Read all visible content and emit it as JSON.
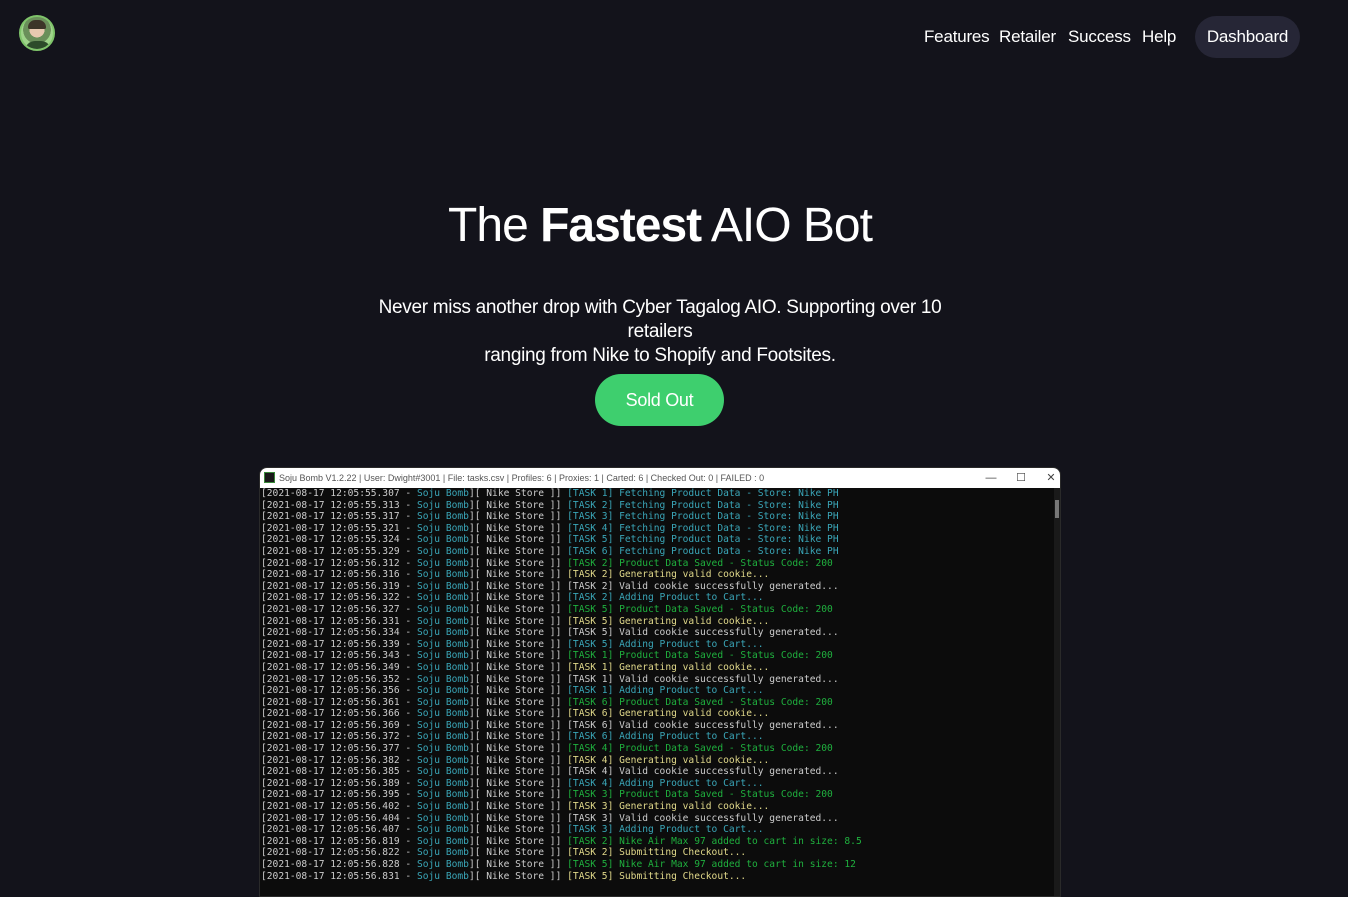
{
  "nav": {
    "links": [
      "Features",
      "Retailer",
      "Success",
      "Help"
    ],
    "dashboard_label": "Dashboard"
  },
  "hero": {
    "title_prefix": "The ",
    "title_bold": "Fastest",
    "title_suffix": " AIO Bot",
    "subtitle_line1": "Never miss another drop with Cyber Tagalog AIO. Supporting over 10 retailers",
    "subtitle_line2": "ranging from Nike to Shopify and Footsites.",
    "cta_label": "Sold Out"
  },
  "colors": {
    "background": "#13131b",
    "cta": "#3ecf6e",
    "dashboard_button": "#262636"
  },
  "console_window": {
    "title": "Soju Bomb V1.2.22 | User: Dwight#3001 | File: tasks.csv | Profiles: 6 | Proxies: 1 | Carted: 6 | Checked Out: 0 | FAILED : 0",
    "controls": [
      "—",
      "☐",
      "✕"
    ],
    "lines": [
      {
        "ts": "[2021-08-17 12:05:55.307 - ",
        "bot": "Soju Bomb",
        "store": "][ Nike Store ]] ",
        "task": "[TASK 1] ",
        "msg": "Fetching Product Data - Store: Nike PH",
        "color": "cyan"
      },
      {
        "ts": "[2021-08-17 12:05:55.313 - ",
        "bot": "Soju Bomb",
        "store": "][ Nike Store ]] ",
        "task": "[TASK 2] ",
        "msg": "Fetching Product Data - Store: Nike PH",
        "color": "cyan"
      },
      {
        "ts": "[2021-08-17 12:05:55.317 - ",
        "bot": "Soju Bomb",
        "store": "][ Nike Store ]] ",
        "task": "[TASK 3] ",
        "msg": "Fetching Product Data - Store: Nike PH",
        "color": "cyan"
      },
      {
        "ts": "[2021-08-17 12:05:55.321 - ",
        "bot": "Soju Bomb",
        "store": "][ Nike Store ]] ",
        "task": "[TASK 4] ",
        "msg": "Fetching Product Data - Store: Nike PH",
        "color": "cyan"
      },
      {
        "ts": "[2021-08-17 12:05:55.324 - ",
        "bot": "Soju Bomb",
        "store": "][ Nike Store ]] ",
        "task": "[TASK 5] ",
        "msg": "Fetching Product Data - Store: Nike PH",
        "color": "cyan"
      },
      {
        "ts": "[2021-08-17 12:05:55.329 - ",
        "bot": "Soju Bomb",
        "store": "][ Nike Store ]] ",
        "task": "[TASK 6] ",
        "msg": "Fetching Product Data - Store: Nike PH",
        "color": "cyan"
      },
      {
        "ts": "[2021-08-17 12:05:56.312 - ",
        "bot": "Soju Bomb",
        "store": "][ Nike Store ]] ",
        "task": "[TASK 2] ",
        "msg": "Product Data Saved - Status Code: 200",
        "color": "green"
      },
      {
        "ts": "[2021-08-17 12:05:56.316 - ",
        "bot": "Soju Bomb",
        "store": "][ Nike Store ]] ",
        "task": "[TASK 2] ",
        "msg": "Generating valid cookie...",
        "color": "yellow"
      },
      {
        "ts": "[2021-08-17 12:05:56.319 - ",
        "bot": "Soju Bomb",
        "store": "][ Nike Store ]] ",
        "task": "[TASK 2] ",
        "msg": "Valid cookie successfully generated...",
        "color": "white"
      },
      {
        "ts": "[2021-08-17 12:05:56.322 - ",
        "bot": "Soju Bomb",
        "store": "][ Nike Store ]] ",
        "task": "[TASK 2] ",
        "msg": "Adding Product to Cart...",
        "color": "cyan"
      },
      {
        "ts": "[2021-08-17 12:05:56.327 - ",
        "bot": "Soju Bomb",
        "store": "][ Nike Store ]] ",
        "task": "[TASK 5] ",
        "msg": "Product Data Saved - Status Code: 200",
        "color": "green"
      },
      {
        "ts": "[2021-08-17 12:05:56.331 - ",
        "bot": "Soju Bomb",
        "store": "][ Nike Store ]] ",
        "task": "[TASK 5] ",
        "msg": "Generating valid cookie...",
        "color": "yellow"
      },
      {
        "ts": "[2021-08-17 12:05:56.334 - ",
        "bot": "Soju Bomb",
        "store": "][ Nike Store ]] ",
        "task": "[TASK 5] ",
        "msg": "Valid cookie successfully generated...",
        "color": "white"
      },
      {
        "ts": "[2021-08-17 12:05:56.339 - ",
        "bot": "Soju Bomb",
        "store": "][ Nike Store ]] ",
        "task": "[TASK 5] ",
        "msg": "Adding Product to Cart...",
        "color": "cyan"
      },
      {
        "ts": "[2021-08-17 12:05:56.343 - ",
        "bot": "Soju Bomb",
        "store": "][ Nike Store ]] ",
        "task": "[TASK 1] ",
        "msg": "Product Data Saved - Status Code: 200",
        "color": "green"
      },
      {
        "ts": "[2021-08-17 12:05:56.349 - ",
        "bot": "Soju Bomb",
        "store": "][ Nike Store ]] ",
        "task": "[TASK 1] ",
        "msg": "Generating valid cookie...",
        "color": "yellow"
      },
      {
        "ts": "[2021-08-17 12:05:56.352 - ",
        "bot": "Soju Bomb",
        "store": "][ Nike Store ]] ",
        "task": "[TASK 1] ",
        "msg": "Valid cookie successfully generated...",
        "color": "white"
      },
      {
        "ts": "[2021-08-17 12:05:56.356 - ",
        "bot": "Soju Bomb",
        "store": "][ Nike Store ]] ",
        "task": "[TASK 1] ",
        "msg": "Adding Product to Cart...",
        "color": "cyan"
      },
      {
        "ts": "[2021-08-17 12:05:56.361 - ",
        "bot": "Soju Bomb",
        "store": "][ Nike Store ]] ",
        "task": "[TASK 6] ",
        "msg": "Product Data Saved - Status Code: 200",
        "color": "green"
      },
      {
        "ts": "[2021-08-17 12:05:56.366 - ",
        "bot": "Soju Bomb",
        "store": "][ Nike Store ]] ",
        "task": "[TASK 6] ",
        "msg": "Generating valid cookie...",
        "color": "yellow"
      },
      {
        "ts": "[2021-08-17 12:05:56.369 - ",
        "bot": "Soju Bomb",
        "store": "][ Nike Store ]] ",
        "task": "[TASK 6] ",
        "msg": "Valid cookie successfully generated...",
        "color": "white"
      },
      {
        "ts": "[2021-08-17 12:05:56.372 - ",
        "bot": "Soju Bomb",
        "store": "][ Nike Store ]] ",
        "task": "[TASK 6] ",
        "msg": "Adding Product to Cart...",
        "color": "cyan"
      },
      {
        "ts": "[2021-08-17 12:05:56.377 - ",
        "bot": "Soju Bomb",
        "store": "][ Nike Store ]] ",
        "task": "[TASK 4] ",
        "msg": "Product Data Saved - Status Code: 200",
        "color": "green"
      },
      {
        "ts": "[2021-08-17 12:05:56.382 - ",
        "bot": "Soju Bomb",
        "store": "][ Nike Store ]] ",
        "task": "[TASK 4] ",
        "msg": "Generating valid cookie...",
        "color": "yellow"
      },
      {
        "ts": "[2021-08-17 12:05:56.385 - ",
        "bot": "Soju Bomb",
        "store": "][ Nike Store ]] ",
        "task": "[TASK 4] ",
        "msg": "Valid cookie successfully generated...",
        "color": "white"
      },
      {
        "ts": "[2021-08-17 12:05:56.389 - ",
        "bot": "Soju Bomb",
        "store": "][ Nike Store ]] ",
        "task": "[TASK 4] ",
        "msg": "Adding Product to Cart...",
        "color": "cyan"
      },
      {
        "ts": "[2021-08-17 12:05:56.395 - ",
        "bot": "Soju Bomb",
        "store": "][ Nike Store ]] ",
        "task": "[TASK 3] ",
        "msg": "Product Data Saved - Status Code: 200",
        "color": "green"
      },
      {
        "ts": "[2021-08-17 12:05:56.402 - ",
        "bot": "Soju Bomb",
        "store": "][ Nike Store ]] ",
        "task": "[TASK 3] ",
        "msg": "Generating valid cookie...",
        "color": "yellow"
      },
      {
        "ts": "[2021-08-17 12:05:56.404 - ",
        "bot": "Soju Bomb",
        "store": "][ Nike Store ]] ",
        "task": "[TASK 3] ",
        "msg": "Valid cookie successfully generated...",
        "color": "white"
      },
      {
        "ts": "[2021-08-17 12:05:56.407 - ",
        "bot": "Soju Bomb",
        "store": "][ Nike Store ]] ",
        "task": "[TASK 3] ",
        "msg": "Adding Product to Cart...",
        "color": "cyan"
      },
      {
        "ts": "[2021-08-17 12:05:56.819 - ",
        "bot": "Soju Bomb",
        "store": "][ Nike Store ]] ",
        "task": "[TASK 2] ",
        "msg": "Nike Air Max 97 added to cart in size: 8.5",
        "color": "green"
      },
      {
        "ts": "[2021-08-17 12:05:56.822 - ",
        "bot": "Soju Bomb",
        "store": "][ Nike Store ]] ",
        "task": "[TASK 2] ",
        "msg": "Submitting Checkout...",
        "color": "yellow"
      },
      {
        "ts": "[2021-08-17 12:05:56.828 - ",
        "bot": "Soju Bomb",
        "store": "][ Nike Store ]] ",
        "task": "[TASK 5] ",
        "msg": "Nike Air Max 97 added to cart in size: 12",
        "color": "green"
      },
      {
        "ts": "[2021-08-17 12:05:56.831 - ",
        "bot": "Soju Bomb",
        "store": "][ Nike Store ]] ",
        "task": "[TASK 5] ",
        "msg": "Submitting Checkout...",
        "color": "yellow"
      }
    ]
  }
}
